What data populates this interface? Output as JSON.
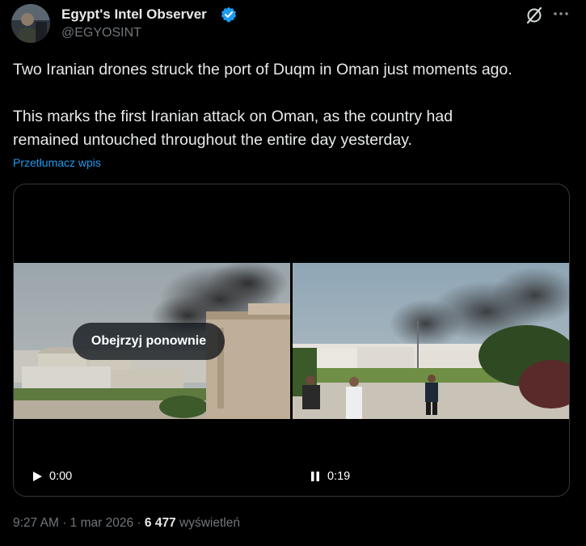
{
  "author": {
    "display_name": "Egypt's Intel Observer",
    "handle": "@EGYOSINT",
    "verified": true
  },
  "tweet": {
    "paragraph_1": "Two Iranian drones struck the port of Duqm in Oman just moments ago.",
    "paragraph_2_line_1": "This marks the first Iranian attack on Oman, as the country had",
    "paragraph_2_line_2": "remained untouched throughout the entire day yesterday.",
    "translate_label": "Przetłumacz wpis"
  },
  "media": {
    "left_video": {
      "replay_label": "Obejrzyj ponownie",
      "control_icon": "play-icon",
      "time": "0:00"
    },
    "right_video": {
      "control_icon": "pause-icon",
      "time": "0:19"
    }
  },
  "meta": {
    "time": "9:27 AM",
    "separator": "·",
    "date": "1 mar 2026",
    "views_count": "6 477",
    "views_label": "wyświetleń"
  },
  "icons": {
    "verified": "verified-badge-icon",
    "grok": "grok-icon",
    "more": "more-options-icon"
  },
  "colors": {
    "background": "#000000",
    "text_primary": "#e7e9ea",
    "text_secondary": "#71767b",
    "link": "#1d9bf0",
    "verified": "#1d9bf0",
    "card_border": "#333639"
  }
}
